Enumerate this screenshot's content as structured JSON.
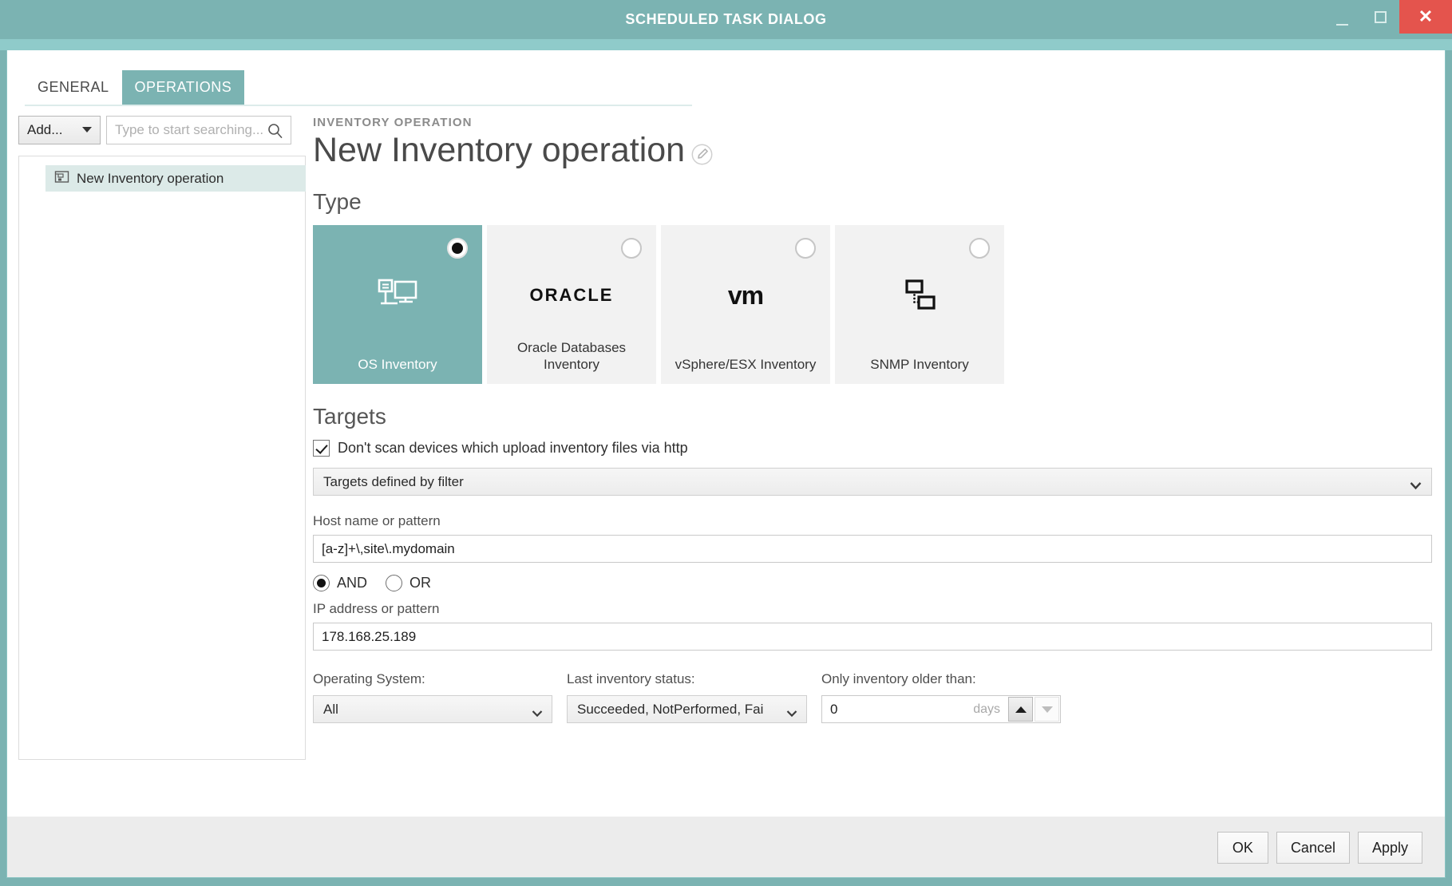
{
  "window": {
    "title": "SCHEDULED TASK DIALOG",
    "minimize_label": "Minimize",
    "maximize_label": "Maximize",
    "close_label": "✕",
    "accent_teal": "#7bb3b2",
    "accent_teal_light": "#8fcbca",
    "close_red": "#e4544d"
  },
  "tabs": [
    {
      "label": "GENERAL",
      "active": false
    },
    {
      "label": "OPERATIONS",
      "active": true
    }
  ],
  "left_panel": {
    "add_button": "Add...",
    "search_placeholder": "Type to start searching...",
    "search_value": "",
    "tree_items": [
      {
        "label": "New Inventory operation",
        "selected": true
      }
    ]
  },
  "main": {
    "kicker": "INVENTORY OPERATION",
    "title": "New Inventory operation",
    "type_section": {
      "heading": "Type",
      "cards": [
        {
          "label": "OS Inventory",
          "icon": "server-monitor-icon",
          "selected": true
        },
        {
          "label": "Oracle Databases Inventory",
          "icon": "oracle-wordmark-icon",
          "wordmark": "ORACLE",
          "selected": false
        },
        {
          "label": "vSphere/ESX Inventory",
          "icon": "vmware-wordmark-icon",
          "wordmark": "vm",
          "selected": false
        },
        {
          "label": "SNMP Inventory",
          "icon": "network-nodes-icon",
          "selected": false
        }
      ]
    },
    "targets_section": {
      "heading": "Targets",
      "skip_http_checkbox": {
        "label": "Don't scan devices which upload inventory files via http",
        "checked": true
      },
      "targets_select": {
        "value": "Targets defined by filter"
      },
      "host_field": {
        "label": "Host name or pattern",
        "value": "[a-z]+\\,site\\.mydomain"
      },
      "logic": {
        "and_label": "AND",
        "or_label": "OR",
        "selected": "AND"
      },
      "ip_field": {
        "label": "IP address or pattern",
        "value": "178.168.25.189"
      },
      "filters": {
        "os": {
          "label": "Operating System:",
          "value": "All"
        },
        "status": {
          "label": "Last inventory status:",
          "value": "Succeeded, NotPerformed, Fai"
        },
        "age": {
          "label": "Only inventory older than:",
          "value": "0",
          "units": "days"
        }
      }
    }
  },
  "footer": {
    "ok": "OK",
    "cancel": "Cancel",
    "apply": "Apply"
  }
}
